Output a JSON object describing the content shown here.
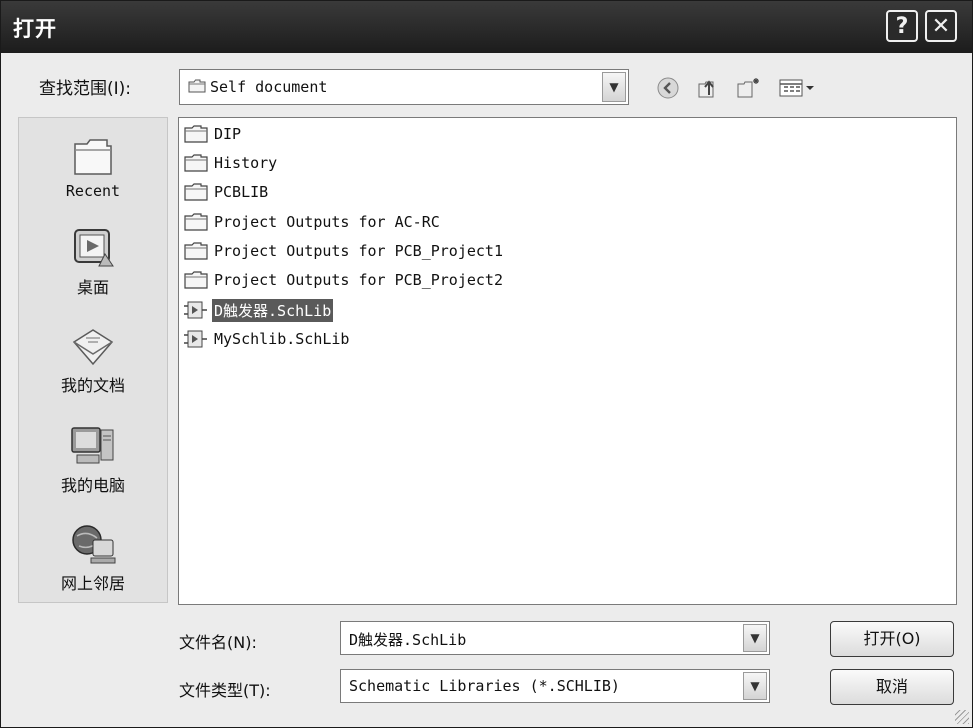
{
  "window": {
    "title": "打开",
    "help_glyph": "?",
    "close_glyph": "✕"
  },
  "toolbar": {
    "lookin_label": "查找范围(I):",
    "lookin_value": "Self document",
    "icons": [
      "back-icon",
      "up-folder-icon",
      "new-folder-icon",
      "view-menu-icon"
    ]
  },
  "places": [
    {
      "label": "Recent",
      "icon": "recent-folder-icon"
    },
    {
      "label": "桌面",
      "icon": "desktop-icon"
    },
    {
      "label": "我的文档",
      "icon": "my-documents-icon"
    },
    {
      "label": "我的电脑",
      "icon": "my-computer-icon"
    },
    {
      "label": "网上邻居",
      "icon": "network-icon"
    }
  ],
  "files": [
    {
      "name": "DIP",
      "type": "folder"
    },
    {
      "name": "History",
      "type": "folder"
    },
    {
      "name": "PCBLIB",
      "type": "folder"
    },
    {
      "name": "Project Outputs for AC-RC",
      "type": "folder"
    },
    {
      "name": "Project Outputs for PCB_Project1",
      "type": "folder"
    },
    {
      "name": "Project Outputs for PCB_Project2",
      "type": "folder"
    },
    {
      "name": "D触发器.SchLib",
      "type": "schlib",
      "selected": true
    },
    {
      "name": "MySchlib.SchLib",
      "type": "schlib"
    }
  ],
  "footer": {
    "filename_label": "文件名(N):",
    "filename_value": "D触发器.SchLib",
    "filetype_label": "文件类型(T):",
    "filetype_value": "Schematic Libraries (*.SCHLIB)",
    "open_label": "打开(O)",
    "cancel_label": "取消"
  },
  "colors": {
    "titlebar": "#2a2a2a",
    "selection": "#5a5a5a",
    "dialog_bg": "#ececec"
  }
}
